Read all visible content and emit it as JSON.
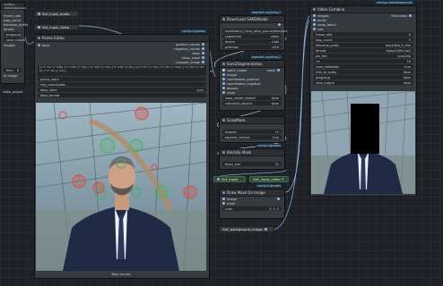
{
  "left_panel": {
    "title": "comfyui-videohelpersuite",
    "rows": [
      "frame_rate",
      "loop_count",
      "filename_prefix",
      "format",
      "pingpong",
      "save_output",
      "images"
    ],
    "output_label": "flnm",
    "output_value": "8",
    "output2_label": "to image",
    "bottom_label": "video_output"
  },
  "set_input_audio": "Set_input_audio",
  "set_input_video": "Set_input_video",
  "mask_editor": {
    "badge": "comfyui-kjnodes",
    "title": "Points Editor",
    "input_label": "bbox",
    "outputs": [
      "positive_coords",
      "negative_coords",
      "bbox",
      "bbox_mask",
      "cropped_image"
    ],
    "coords_text": "[{\"x\":31,\"y\":108},{\"x\":190,\"y\":49},{\"x\":164,\"y\":43},{\"x\":150,\"y\":81}]  [{\"x\":87,\"y\":12},{\"x\":63,\"y\":165},{\"x\":152,\"y\":159},{\"x\":10,\"y\":11}]",
    "widget_labels": [
      "points_store",
      "neg_coordinates",
      "bbox_store",
      "bbox_format"
    ],
    "widget_values": [
      "",
      "",
      "xyxy",
      ""
    ],
    "footer": "New canvas"
  },
  "sam2_model": {
    "badge": "segment-anything-2",
    "title": "DownLoad SAM2Model",
    "widgets": [
      {
        "label": "model",
        "value": "sam2_hiera_base_plus.safetensors"
      },
      {
        "label": "segmentor",
        "value": "video"
      },
      {
        "label": "device",
        "value": "cuda"
      },
      {
        "label": "precision",
        "value": "bf16"
      }
    ]
  },
  "sam2_segmentation": {
    "badge": "segment-anything-2",
    "title": "Sam2Segmentation",
    "inputs": [
      "sam2_model",
      "image",
      "coordinates_positive",
      "coordinates_negative",
      "bboxes",
      "mask"
    ],
    "widgets": [
      {
        "label": "keep_model_loaded",
        "value": "false"
      },
      {
        "label": "individual_objects",
        "value": "false"
      }
    ],
    "output": "mask"
  },
  "grow_mask": {
    "title": "GrowMask",
    "widgets": [
      {
        "label": "expand",
        "value": "10"
      },
      {
        "label": "tapered_corners",
        "value": "true"
      }
    ]
  },
  "blockify": {
    "badge": "comfyui-kjnodes",
    "title": "Blockify Mask",
    "widget_label": "block_size",
    "widget_value": "32"
  },
  "green_nodes": {
    "set_mask": "Set_mask",
    "get_input_video": "Get_input_video",
    "get_background_image": "Get_background_image"
  },
  "draw_mask": {
    "badge": "comfyui-kjnodes",
    "title": "Draw Mask On Image",
    "inputs": [
      "image",
      "mask"
    ],
    "widget_label": "color",
    "widget_value": "0, 0, 0"
  },
  "video_combine": {
    "badge": "comfyui-videohelpersuite",
    "title": "Video Combine",
    "inputs": [
      "images",
      "audio",
      "meta_batch",
      "vae"
    ],
    "output": "Filenames",
    "widgets": [
      {
        "label": "frame_rate",
        "value": "8"
      },
      {
        "label": "loop_count",
        "value": "0"
      },
      {
        "label": "filename_prefix",
        "value": "blockified_fl_film"
      },
      {
        "label": "format",
        "value": "video/h264-mp4"
      },
      {
        "label": "pix_fmt",
        "value": "yuv420p"
      },
      {
        "label": "crf",
        "value": "19"
      },
      {
        "label": "save_metadata",
        "value": "true"
      },
      {
        "label": "trim_to_audio",
        "value": "false"
      },
      {
        "label": "pingpong",
        "value": "false"
      },
      {
        "label": "save_output",
        "value": "false"
      }
    ]
  },
  "colors": {
    "node_bg": "#353a3f",
    "header_bg": "#2b2f33",
    "wire_blue": "#8fb7e8",
    "wire_white": "#cfd7df",
    "green_node": "#2f4a34",
    "point_red": "#e0493c",
    "point_green": "#41b45a"
  }
}
